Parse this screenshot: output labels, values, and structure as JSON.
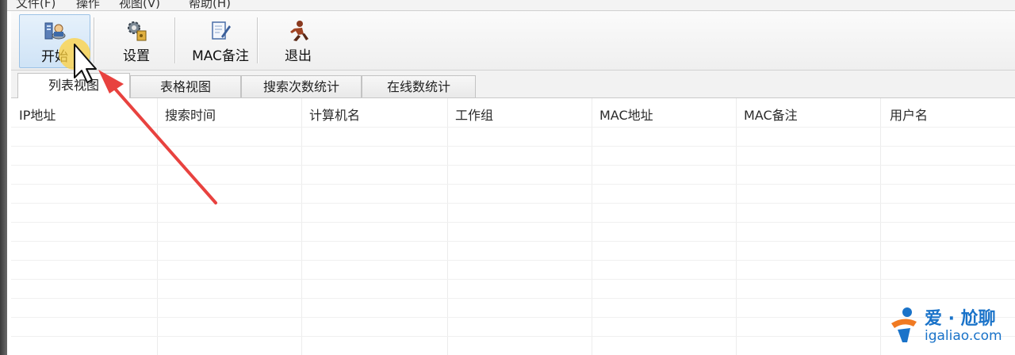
{
  "menubar": {
    "items": [
      "文件(F)",
      "操作",
      "视图(V)",
      "帮助(H)"
    ]
  },
  "toolbar": {
    "start_label": "开始",
    "settings_label": "设置",
    "mac_note_label": "MAC备注",
    "exit_label": "退出"
  },
  "tabs": [
    {
      "label": "列表视图"
    },
    {
      "label": "表格视图"
    },
    {
      "label": "搜索次数统计"
    },
    {
      "label": "在线数统计"
    }
  ],
  "table": {
    "columns": [
      "IP地址",
      "搜索时间",
      "计算机名",
      "工作组",
      "MAC地址",
      "MAC备注",
      "用户名"
    ]
  },
  "watermark": {
    "top_text": "爱 · 尬聊",
    "url": "igaliao.com"
  },
  "colors": {
    "accent_red": "#e8423f",
    "watermark_blue": "#1a73c9",
    "cursor_highlight": "#ffd23f"
  }
}
